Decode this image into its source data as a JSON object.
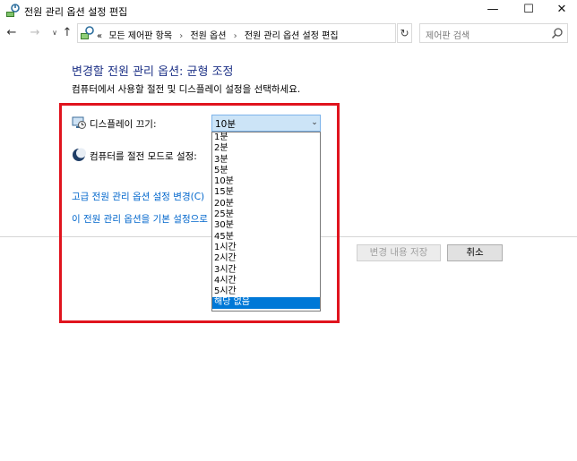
{
  "window": {
    "title": "전원 관리 옵션 설정 편집",
    "minimize_symbol": "—",
    "maximize_symbol": "☐",
    "close_symbol": "✕"
  },
  "nav": {
    "back_symbol": "←",
    "forward_symbol": "→",
    "recent_symbol": "∨",
    "up_symbol": "↑",
    "refresh_symbol": "↻",
    "address_dropdown_symbol": "∨"
  },
  "address": {
    "overflow": "«",
    "breadcrumbs": [
      "모든 제어판 항목",
      "전원 옵션",
      "전원 관리 옵션 설정 편집"
    ],
    "separator": "›"
  },
  "search": {
    "placeholder": "제어판 검색"
  },
  "content": {
    "title": "변경할 전원 관리 옵션: 균형 조정",
    "description": "컴퓨터에서 사용할 절전 및 디스플레이 설정을 선택하세요.",
    "display_off_label": "디스플레이 끄기:",
    "sleep_label": "컴퓨터를 절전 모드로 설정:",
    "display_off_value": "10분",
    "select_arrow_symbol": "⌄",
    "advanced_link": "고급 전원 관리 옵션 설정 변경(C)",
    "restore_link": "이 전원 관리 옵션을 기본 설정으로",
    "save_button": "변경 내용 저장",
    "cancel_button": "취소"
  },
  "dropdown": {
    "options": [
      "1분",
      "2분",
      "3분",
      "5분",
      "10분",
      "15분",
      "20분",
      "25분",
      "30분",
      "45분",
      "1시간",
      "2시간",
      "3시간",
      "4시간",
      "5시간",
      "해당 없음"
    ],
    "highlighted_option": "해당 없음"
  },
  "colors": {
    "title_blue": "#1e3287",
    "link_blue": "#0066cc",
    "selection_blue": "#0078d7",
    "highlight_red": "#e0141e"
  },
  "icons": {
    "app": "power-options-icon",
    "display": "monitor-clock-icon",
    "sleep": "moon-icon",
    "search": "magnifier-icon"
  }
}
